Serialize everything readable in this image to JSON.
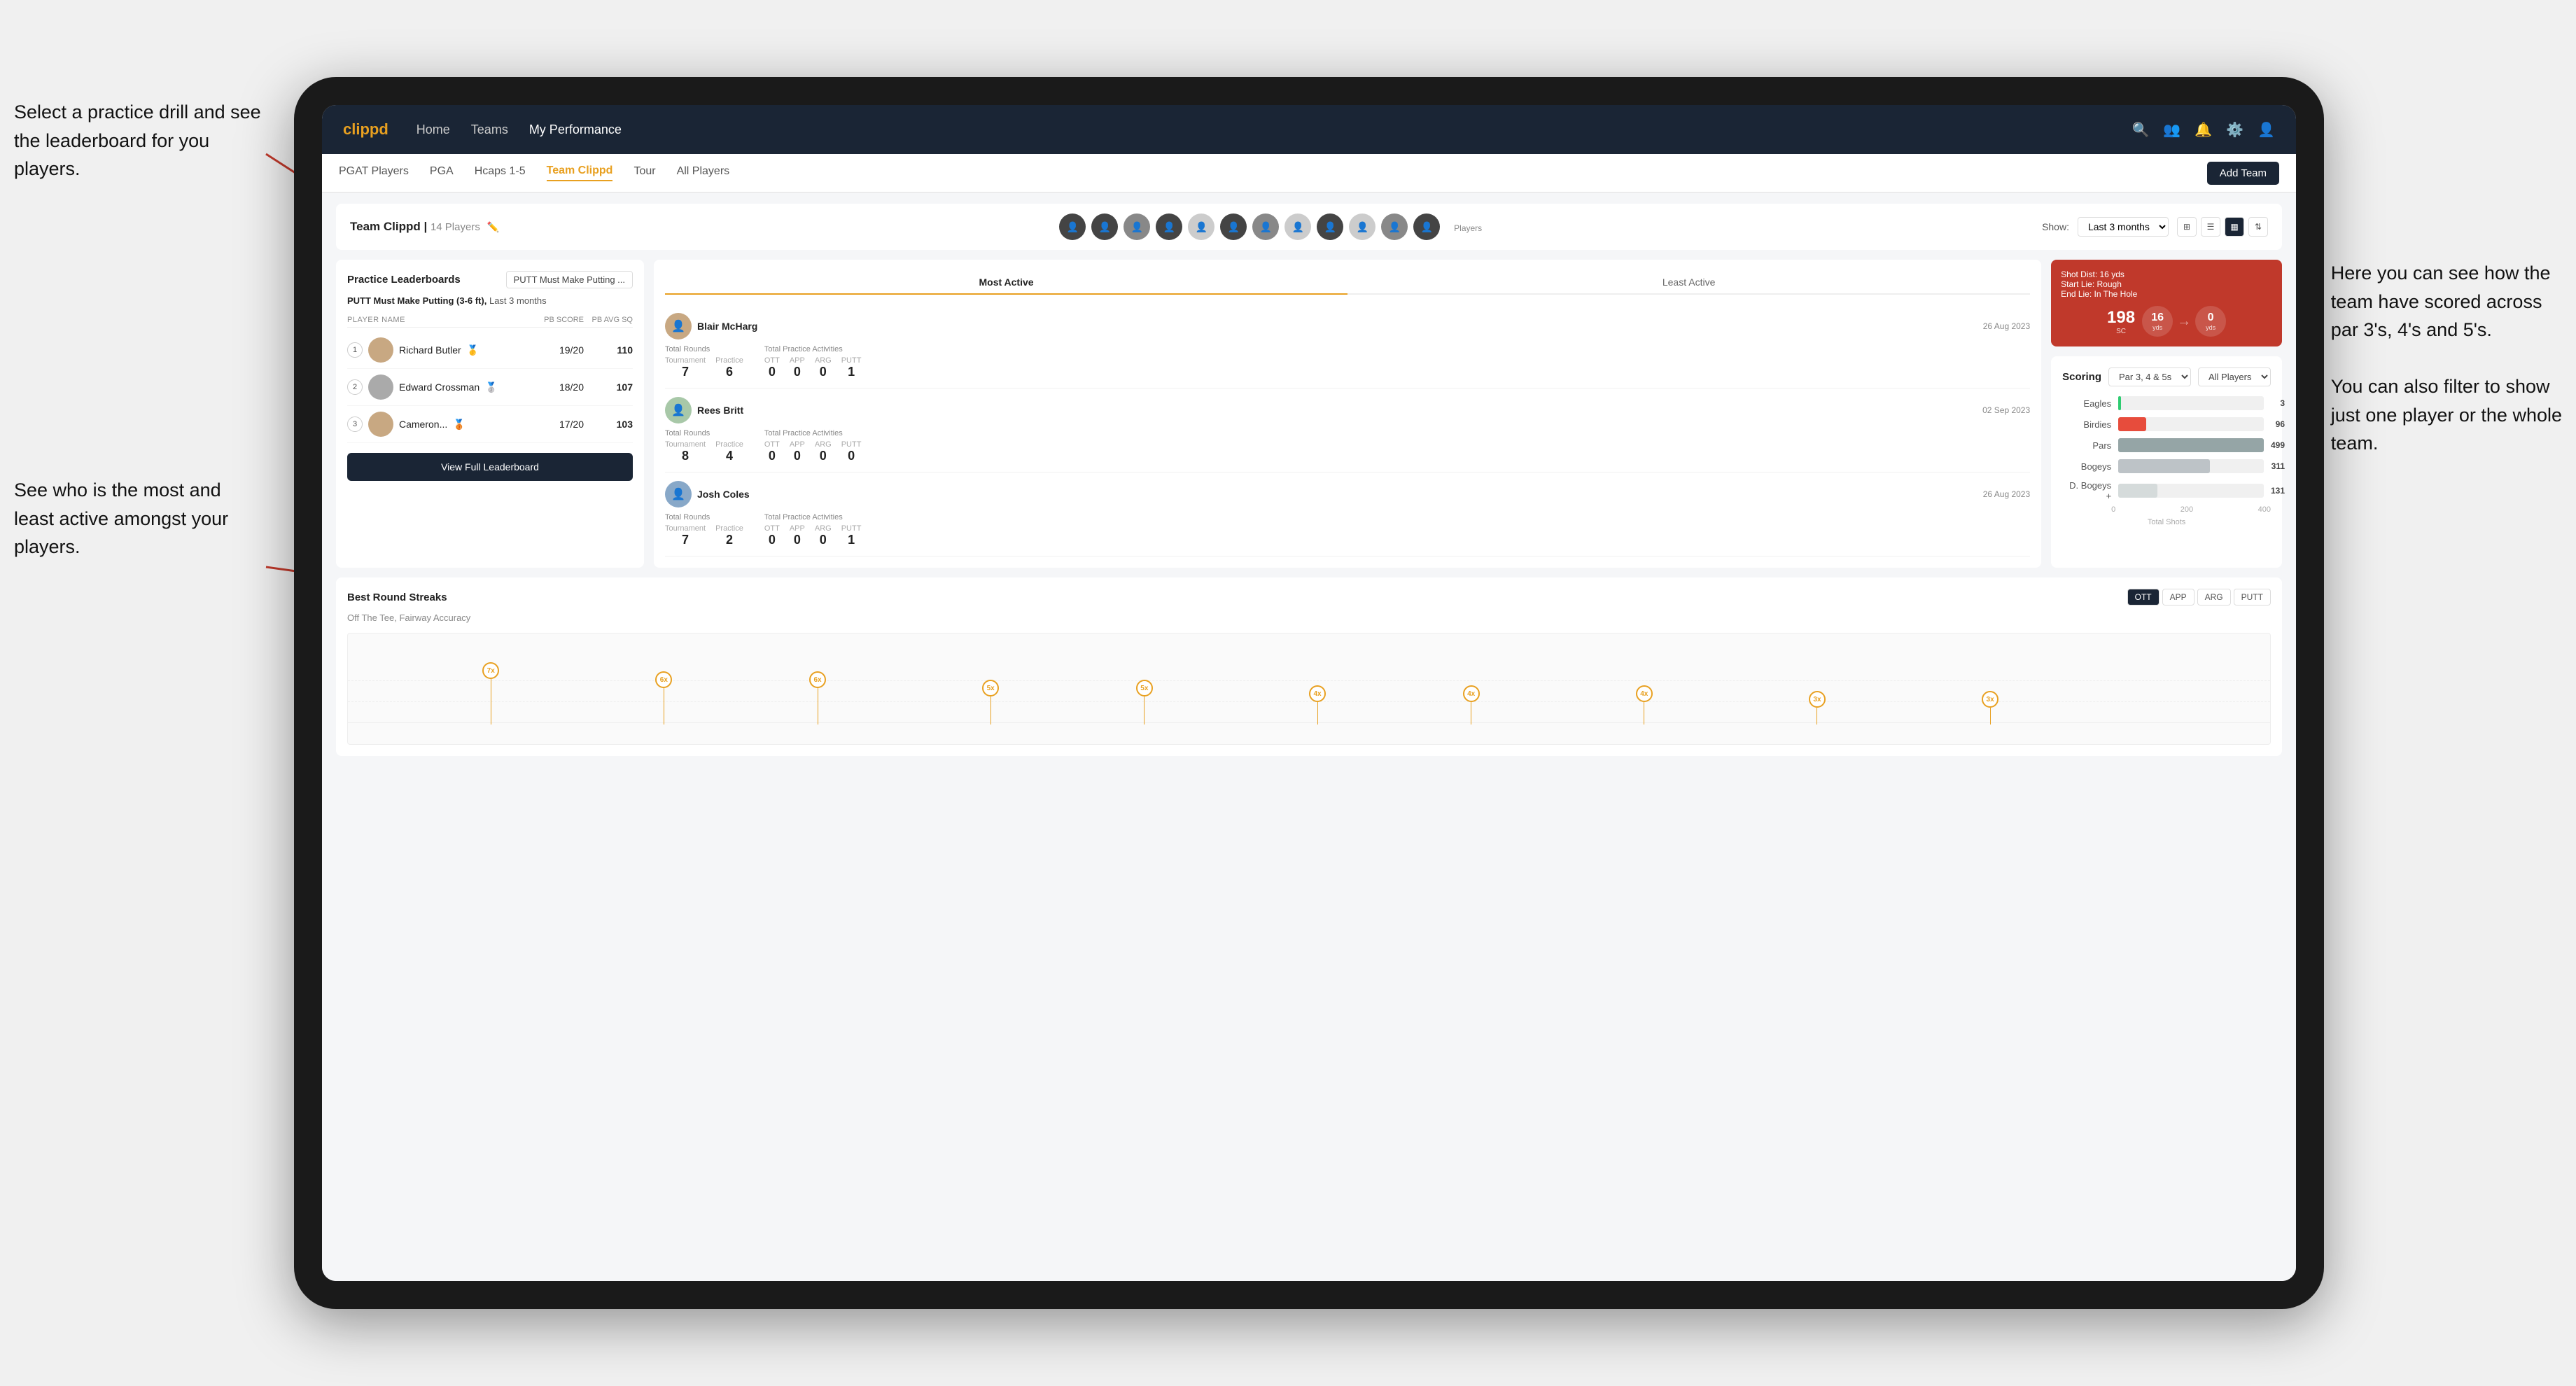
{
  "annotations": {
    "left1": "Select a practice drill and see\nthe leaderboard for you players.",
    "left2": "See who is the most and least\nactive amongst your players.",
    "right1": "Here you can see how the\nteam have scored across\npar 3's, 4's and 5's.\n\nYou can also filter to show\njust one player or the whole\nteam."
  },
  "nav": {
    "logo": "clippd",
    "items": [
      "Home",
      "Teams",
      "My Performance"
    ],
    "icons": [
      "🔍",
      "👤",
      "🔔",
      "⚙️",
      "👤"
    ]
  },
  "subnav": {
    "items": [
      "PGAT Players",
      "PGA",
      "Hcaps 1-5",
      "Team Clippd",
      "Tour",
      "All Players"
    ],
    "active": "Team Clippd",
    "add_team_label": "Add Team"
  },
  "team_header": {
    "title": "Team Clippd",
    "player_count": "14 Players",
    "show_label": "Show:",
    "period": "Last 3 months",
    "players_label": "Players"
  },
  "practice_leaderboard": {
    "title": "Practice Leaderboards",
    "dropdown": "PUTT Must Make Putting ...",
    "subtitle": "PUTT Must Make Putting (3-6 ft),",
    "period": "Last 3 months",
    "table_headers": [
      "PLAYER NAME",
      "PB SCORE",
      "PB AVG SQ"
    ],
    "players": [
      {
        "rank": "1",
        "name": "Richard Butler",
        "score": "19/20",
        "avg": "110",
        "medal": "🥇"
      },
      {
        "rank": "2",
        "name": "Edward Crossman",
        "score": "18/20",
        "avg": "107",
        "medal": "🥈"
      },
      {
        "rank": "3",
        "name": "Cameron...",
        "score": "17/20",
        "avg": "103",
        "medal": "🥉"
      }
    ],
    "view_full_label": "View Full Leaderboard"
  },
  "activity": {
    "tabs": [
      "Most Active",
      "Least Active"
    ],
    "active_tab": "Most Active",
    "players": [
      {
        "name": "Blair McHarg",
        "date": "26 Aug 2023",
        "total_rounds_label": "Total Rounds",
        "tournament": "7",
        "practice": "6",
        "total_practice_label": "Total Practice Activities",
        "ott": "0",
        "app": "0",
        "arg": "0",
        "putt": "1"
      },
      {
        "name": "Rees Britt",
        "date": "02 Sep 2023",
        "total_rounds_label": "Total Rounds",
        "tournament": "8",
        "practice": "4",
        "total_practice_label": "Total Practice Activities",
        "ott": "0",
        "app": "0",
        "arg": "0",
        "putt": "0"
      },
      {
        "name": "Josh Coles",
        "date": "26 Aug 2023",
        "total_rounds_label": "Total Rounds",
        "tournament": "7",
        "practice": "2",
        "total_practice_label": "Total Practice Activities",
        "ott": "0",
        "app": "0",
        "arg": "0",
        "putt": "1"
      }
    ]
  },
  "scoring": {
    "title": "Scoring",
    "filter1": "Par 3, 4 & 5s",
    "filter2": "All Players",
    "bars": [
      {
        "label": "Eagles",
        "value": 3,
        "max": 499,
        "color": "#2ecc71"
      },
      {
        "label": "Birdies",
        "value": 96,
        "max": 499,
        "color": "#e74c3c"
      },
      {
        "label": "Pars",
        "value": 499,
        "max": 499,
        "color": "#95a5a6"
      },
      {
        "label": "Bogeys",
        "value": 311,
        "max": 499,
        "color": "#bdc3c7"
      },
      {
        "label": "D. Bogeys +",
        "value": 131,
        "max": 499,
        "color": "#d5dbdb"
      }
    ],
    "x_labels": [
      "0",
      "200",
      "400"
    ],
    "x_axis_label": "Total Shots"
  },
  "shot_info": {
    "shot_dist": "Shot Dist: 16 yds",
    "start_lie": "Start Lie: Rough",
    "end_lie": "End Lie: In The Hole",
    "value1": "198",
    "unit1": "SC",
    "value2": "16",
    "unit2": "yds",
    "value3": "0",
    "unit3": "yds"
  },
  "streaks": {
    "title": "Best Round Streaks",
    "filters": [
      "OTT",
      "APP",
      "ARG",
      "PUTT"
    ],
    "active_filter": "OTT",
    "subtitle": "Off The Tee, Fairway Accuracy",
    "nodes": [
      {
        "x": 8,
        "value": "7x",
        "height": 80
      },
      {
        "x": 15,
        "value": "6x",
        "height": 65
      },
      {
        "x": 22,
        "value": "6x",
        "height": 65
      },
      {
        "x": 30,
        "value": "5x",
        "height": 50
      },
      {
        "x": 37,
        "value": "5x",
        "height": 50
      },
      {
        "x": 45,
        "value": "4x",
        "height": 40
      },
      {
        "x": 52,
        "value": "4x",
        "height": 40
      },
      {
        "x": 59,
        "value": "4x",
        "height": 40
      },
      {
        "x": 67,
        "value": "3x",
        "height": 30
      },
      {
        "x": 74,
        "value": "3x",
        "height": 30
      }
    ]
  }
}
